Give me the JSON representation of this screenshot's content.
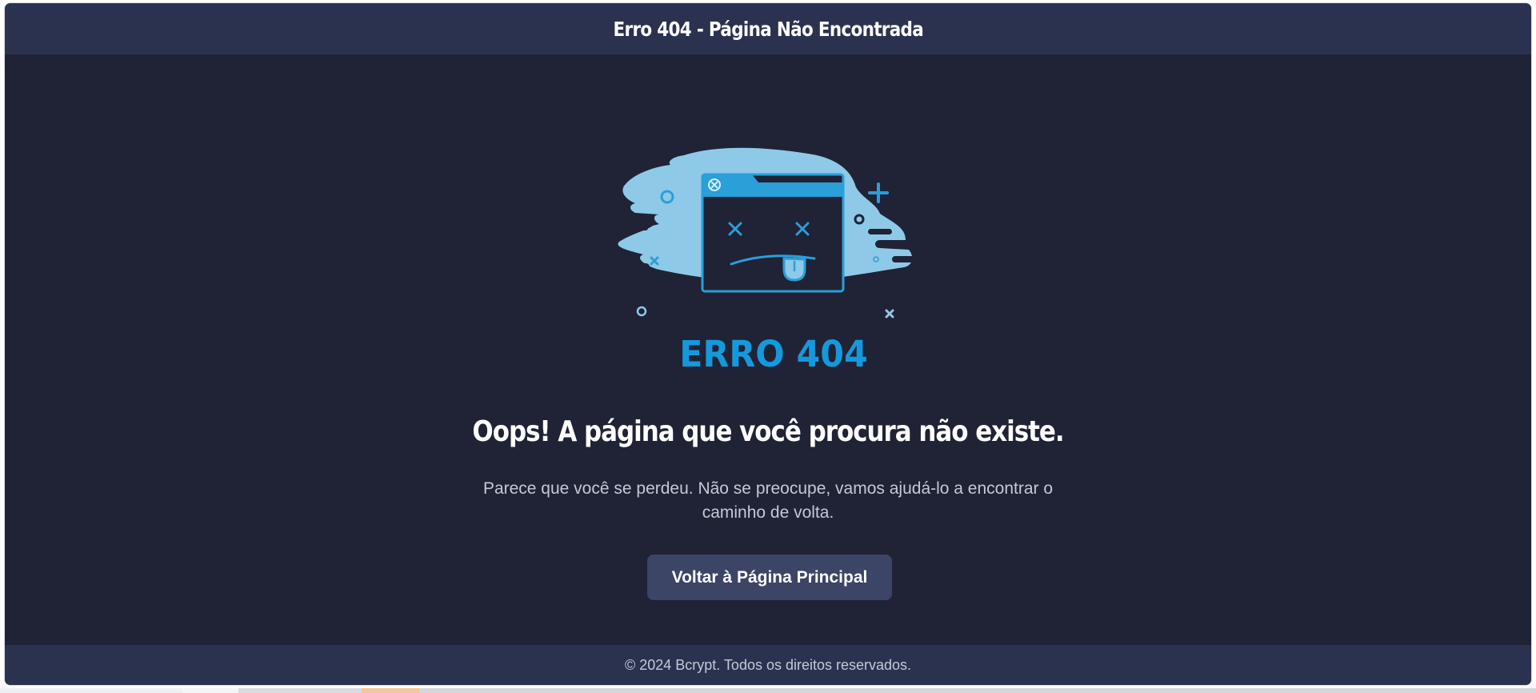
{
  "header": {
    "title": "Erro 404 - Página Não Encontrada"
  },
  "illustration": {
    "icon": "sad-browser-window-icon",
    "caption": "ERRO 404",
    "colors": {
      "blob": "#8fc9e8",
      "accent": "#2a9fd8",
      "window_fill": "#1f2335"
    }
  },
  "main": {
    "headline": "Oops! A página que você procura não existe.",
    "description": "Parece que você se perdeu. Não se preocupe, vamos ajudá-lo a encontrar o caminho de volta.",
    "home_button_label": "Voltar à Página Principal"
  },
  "footer": {
    "text": "© 2024 Bcrypt. Todos os direitos reservados."
  },
  "theme": {
    "background": "#1f2335",
    "bar": "#2b3250",
    "button": "#3c4566"
  }
}
